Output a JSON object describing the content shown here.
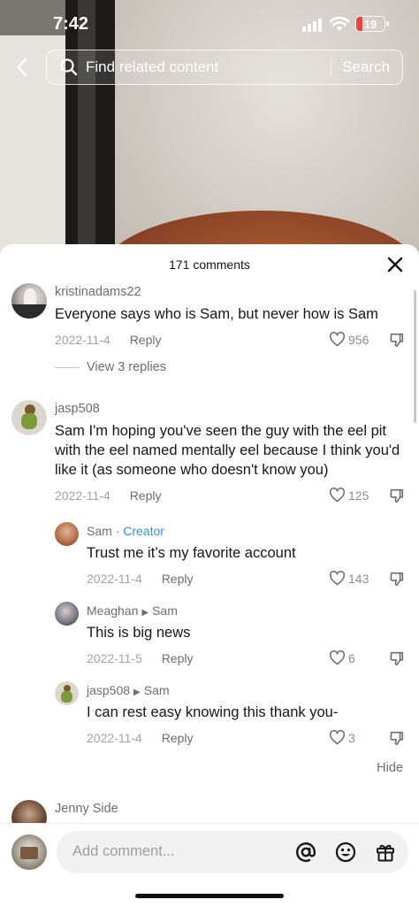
{
  "status_bar": {
    "time": "7:42",
    "battery": "19"
  },
  "search": {
    "placeholder": "Find related content",
    "button": "Search"
  },
  "comments_sheet": {
    "count_label": "171 comments",
    "comments": [
      {
        "user": "kristinadams22",
        "text": "Everyone says who is Sam, but never how is Sam",
        "date": "2022-11-4",
        "reply_label": "Reply",
        "likes": "956",
        "view_replies": "View 3 replies"
      },
      {
        "user": "jasp508",
        "text": "Sam I'm hoping you've seen the guy with the eel pit with the eel named mentally eel because I think you'd like it (as someone who doesn't know you)",
        "date": "2022-11-4",
        "reply_label": "Reply",
        "likes": "125",
        "replies": [
          {
            "user": "Sam",
            "creator_badge": "Creator",
            "text": "Trust me it’s my favorite account",
            "date": "2022-11-4",
            "reply_label": "Reply",
            "likes": "143"
          },
          {
            "user": "Meaghan",
            "reply_to": "Sam",
            "text": "This is big news",
            "date": "2022-11-5",
            "reply_label": "Reply",
            "likes": "6"
          },
          {
            "user": "jasp508",
            "reply_to": "Sam",
            "text": "I can rest easy knowing this thank you-",
            "date": "2022-11-4",
            "reply_label": "Reply",
            "likes": "3"
          }
        ],
        "hide_label": "Hide"
      },
      {
        "user": "Jenny Side"
      }
    ]
  },
  "comment_bar": {
    "placeholder": "Add comment..."
  },
  "colors": {
    "creator": "#3a8fd0",
    "battery_low": "#e8453c"
  }
}
